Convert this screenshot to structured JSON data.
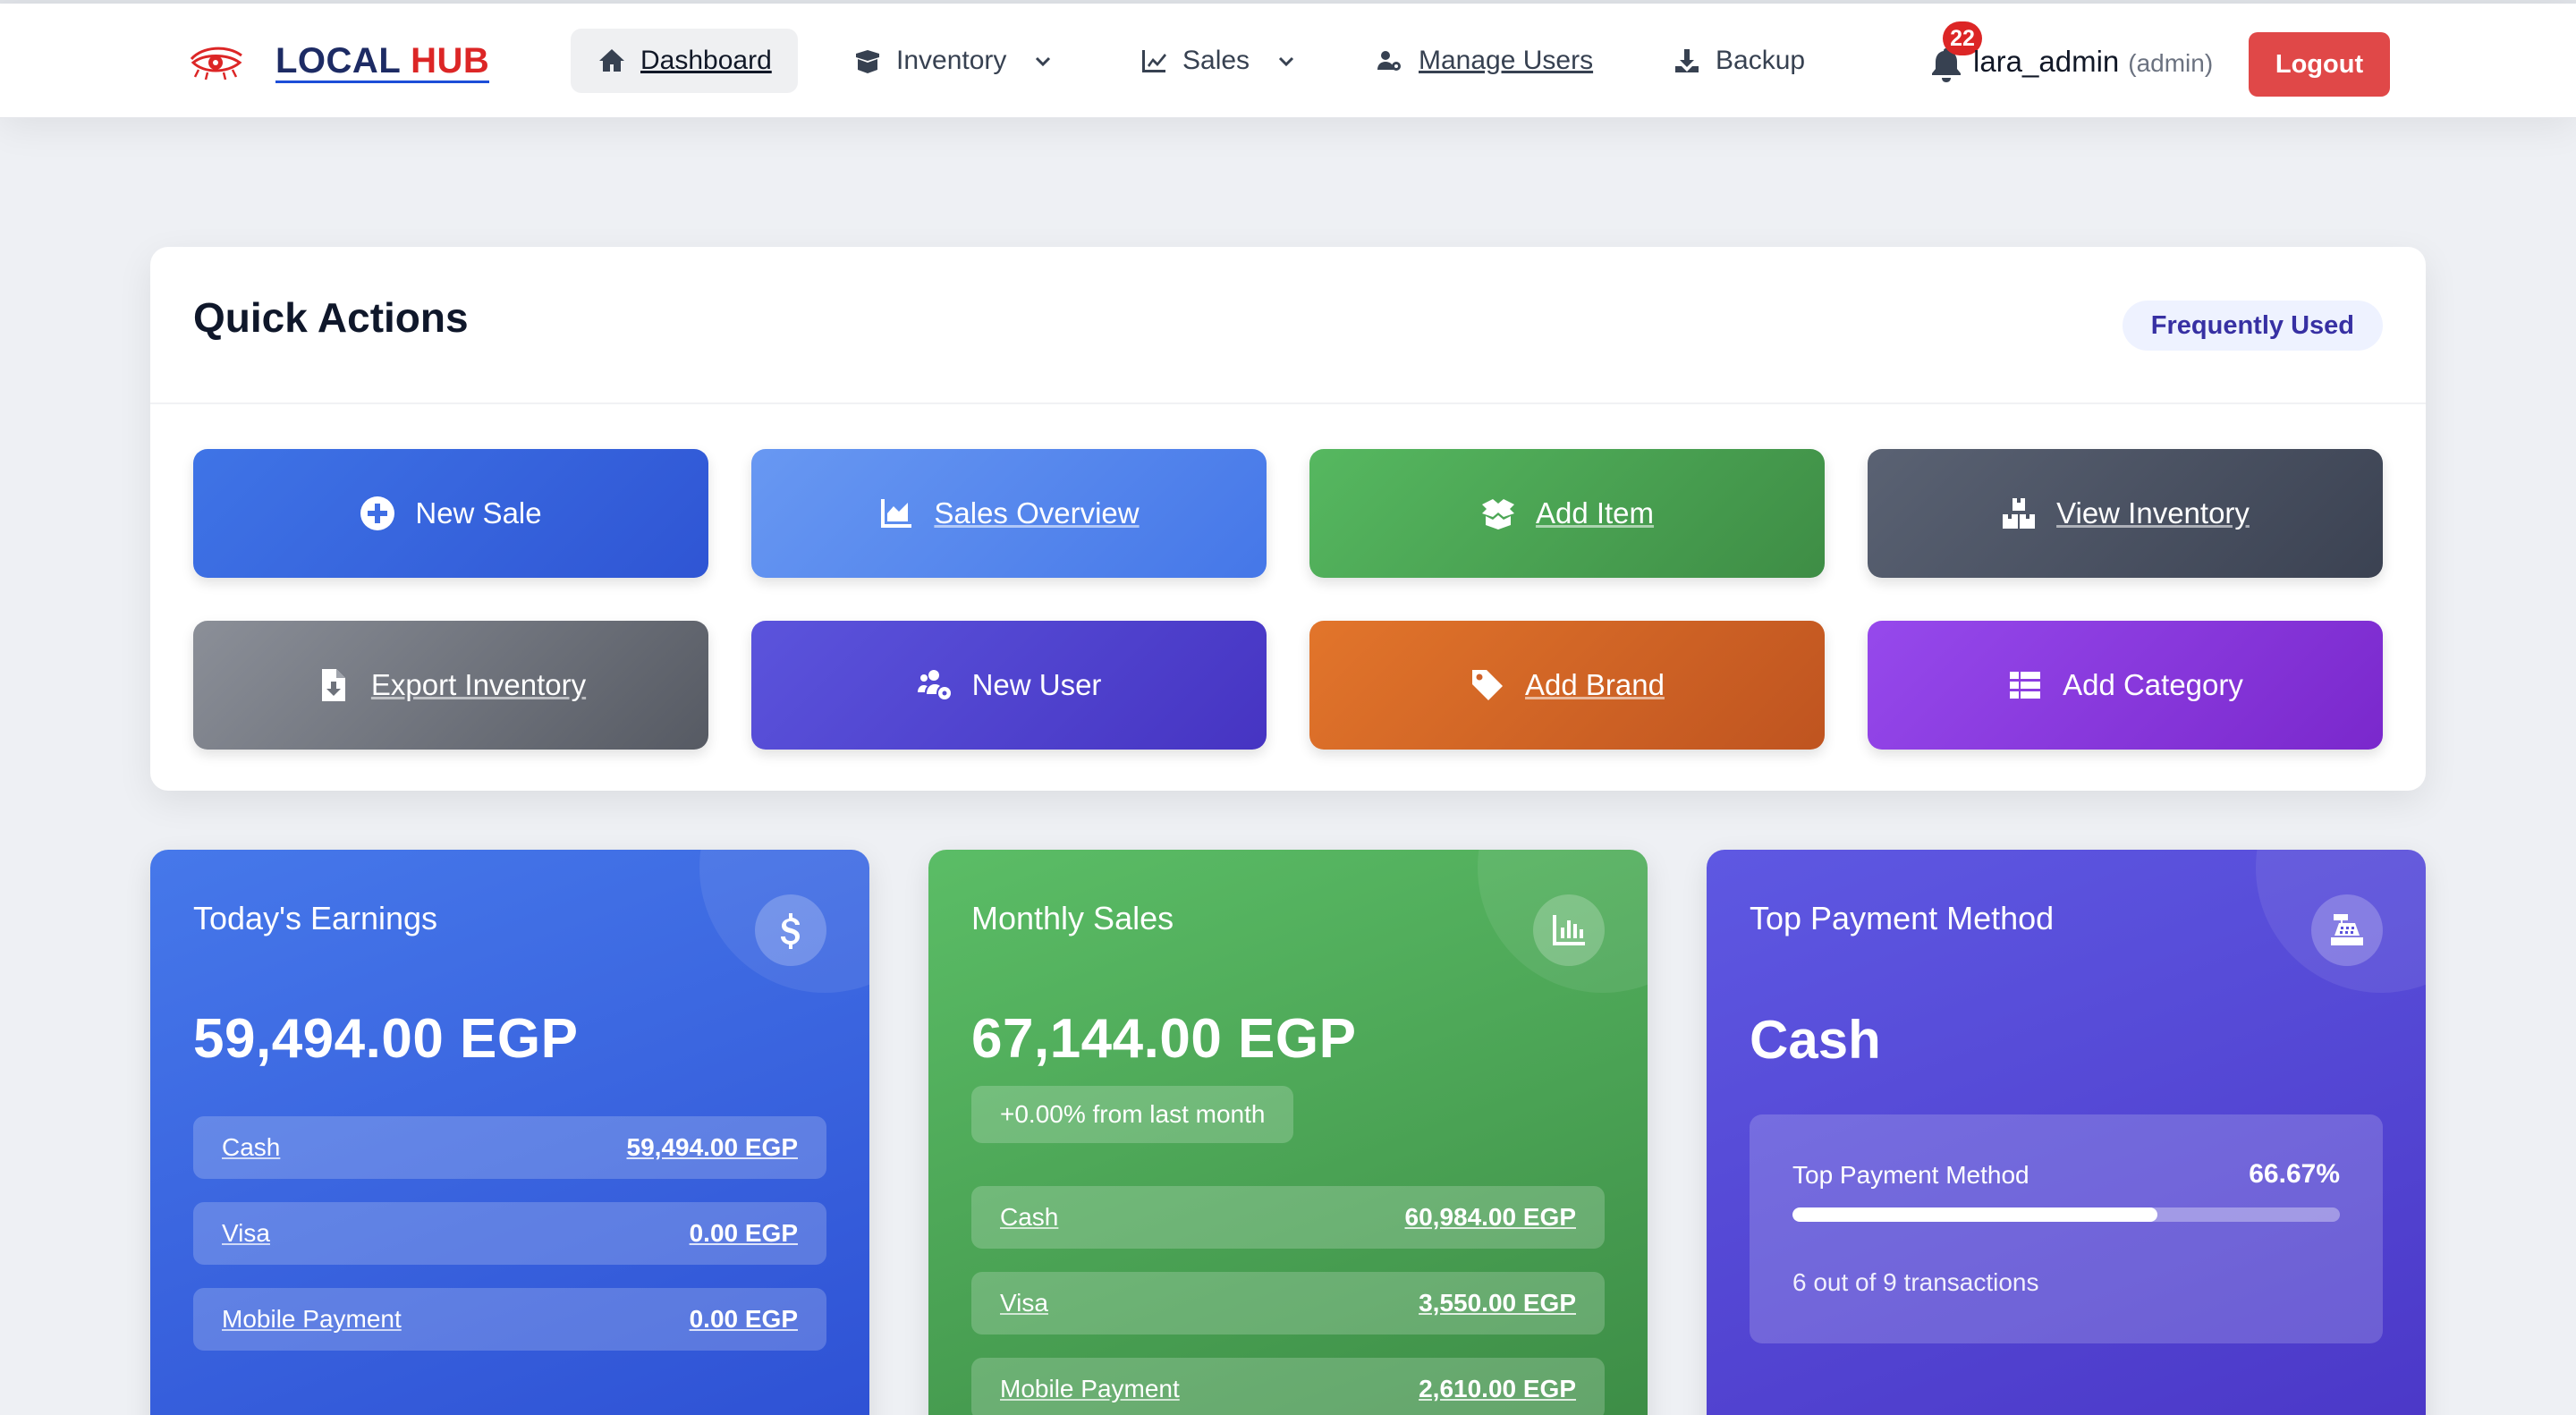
{
  "navbar": {
    "brand": {
      "local": "LOCAL ",
      "hub": "HUB"
    },
    "items": [
      {
        "label": "Dashboard",
        "icon": "home-icon"
      },
      {
        "label": "Inventory",
        "icon": "box-open-icon",
        "dropdown": true
      },
      {
        "label": "Sales",
        "icon": "line-chart-icon",
        "dropdown": true
      },
      {
        "label": "Manage Users",
        "icon": "users-cog-icon"
      },
      {
        "label": "Backup",
        "icon": "download-icon"
      }
    ],
    "notifications_count": "22",
    "username": "lara_admin",
    "role": "(admin)",
    "logout_label": "Logout"
  },
  "quick_actions": {
    "title": "Quick Actions",
    "badge": "Frequently Used",
    "buttons": [
      {
        "label": "New Sale",
        "icon": "plus-circle-icon"
      },
      {
        "label": "Sales Overview",
        "icon": "chart-area-icon"
      },
      {
        "label": "Add Item",
        "icon": "box-open-icon"
      },
      {
        "label": "View Inventory",
        "icon": "boxes-icon"
      },
      {
        "label": "Export Inventory",
        "icon": "file-export-icon"
      },
      {
        "label": "New User",
        "icon": "users-cog-icon"
      },
      {
        "label": "Add Brand",
        "icon": "tag-icon"
      },
      {
        "label": "Add Category",
        "icon": "th-list-icon"
      }
    ]
  },
  "cards": {
    "earnings": {
      "title": "Today's Earnings",
      "value": "59,494.00 EGP",
      "icon": "dollar-icon",
      "methods": [
        {
          "name": "Cash",
          "amount": "59,494.00 EGP"
        },
        {
          "name": "Visa",
          "amount": "0.00 EGP"
        },
        {
          "name": "Mobile Payment",
          "amount": "0.00 EGP"
        }
      ]
    },
    "monthly": {
      "title": "Monthly Sales",
      "value": "67,144.00 EGP",
      "change": "+0.00% from last month",
      "icon": "bar-chart-icon",
      "methods": [
        {
          "name": "Cash",
          "amount": "60,984.00 EGP"
        },
        {
          "name": "Visa",
          "amount": "3,550.00 EGP"
        },
        {
          "name": "Mobile Payment",
          "amount": "2,610.00 EGP"
        }
      ]
    },
    "payment": {
      "title": "Top Payment Method",
      "method": "Cash",
      "icon": "cash-register-icon",
      "label": "Top Payment Method",
      "percent": "66.67%",
      "percent_value": 66.67,
      "note": "6 out of 9 transactions"
    }
  }
}
